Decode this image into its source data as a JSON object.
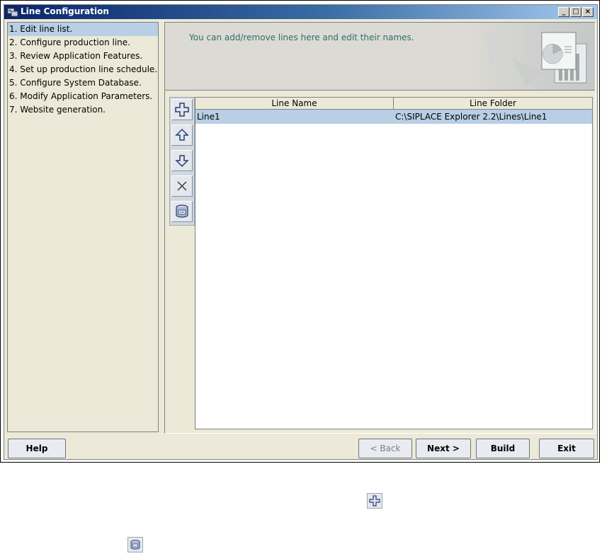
{
  "window": {
    "title": "Line Configuration",
    "minimize": "_",
    "maximize": "□",
    "close": "×"
  },
  "sidebar": {
    "steps": [
      {
        "label": "1. Edit line list."
      },
      {
        "label": "2. Configure production line."
      },
      {
        "label": "3. Review Application Features."
      },
      {
        "label": "4. Set up production line schedule."
      },
      {
        "label": "5. Configure System Database."
      },
      {
        "label": "6. Modify Application Parameters."
      },
      {
        "label": "7. Website generation."
      }
    ],
    "active_step": 1
  },
  "header": {
    "instruction": "You can add/remove lines here and edit their names."
  },
  "toolbar": {
    "buttons": [
      {
        "icon": "add-icon"
      },
      {
        "icon": "move-up-icon"
      },
      {
        "icon": "move-down-icon"
      },
      {
        "icon": "delete-icon"
      },
      {
        "icon": "database-icon"
      }
    ]
  },
  "table": {
    "columns": [
      "Line Name",
      "Line Folder"
    ],
    "rows": [
      [
        "Line1",
        "C:\\SIPLACE Explorer 2.2\\Lines\\Line1"
      ]
    ]
  },
  "buttons": {
    "help": "Help",
    "back": "< Back",
    "next": "Next >",
    "build": "Build",
    "exit": "Exit"
  },
  "colors": {
    "selection": "#b8cfe5",
    "header_text": "#2e6e6e",
    "title_bar": "#0a246a"
  }
}
